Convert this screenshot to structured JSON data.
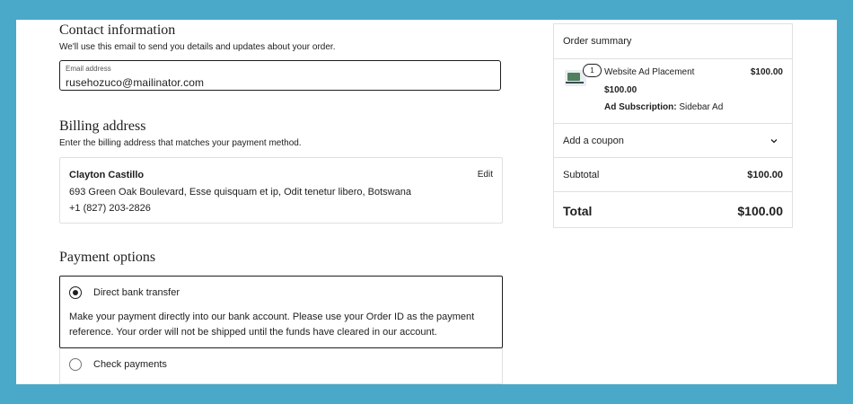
{
  "contact": {
    "title": "Contact information",
    "subtitle": "We'll use this email to send you details and updates about your order.",
    "email_label": "Email address",
    "email_value": "rusehozuco@mailinator.com"
  },
  "billing": {
    "title": "Billing address",
    "subtitle": "Enter the billing address that matches your payment method.",
    "name": "Clayton Castillo",
    "address": "693 Green Oak Boulevard, Esse quisquam et ip, Odit tenetur libero, Botswana",
    "phone": "+1 (827) 203-2826",
    "edit_label": "Edit"
  },
  "payment": {
    "title": "Payment options",
    "options": [
      {
        "label": "Direct bank transfer",
        "selected": true,
        "description": "Make your payment directly into our bank account. Please use your Order ID as the payment reference. Your order will not be shipped until the funds have cleared in our account."
      },
      {
        "label": "Check payments",
        "selected": false
      }
    ]
  },
  "summary": {
    "title": "Order summary",
    "item": {
      "quantity": "1",
      "name": "Website Ad Placement",
      "line_total": "$100.00",
      "price": "$100.00",
      "meta_key": "Ad Subscription:",
      "meta_value": " Sidebar Ad",
      "icon": "computer-monitor-icon"
    },
    "coupon_label": "Add a coupon",
    "subtotal_label": "Subtotal",
    "subtotal_value": "$100.00",
    "total_label": "Total",
    "total_value": "$100.00"
  },
  "colors": {
    "page_background": "#4aa8c9",
    "panel_background": "#ffffff",
    "text": "#1e1e1e",
    "border": "#e0e0e0"
  }
}
